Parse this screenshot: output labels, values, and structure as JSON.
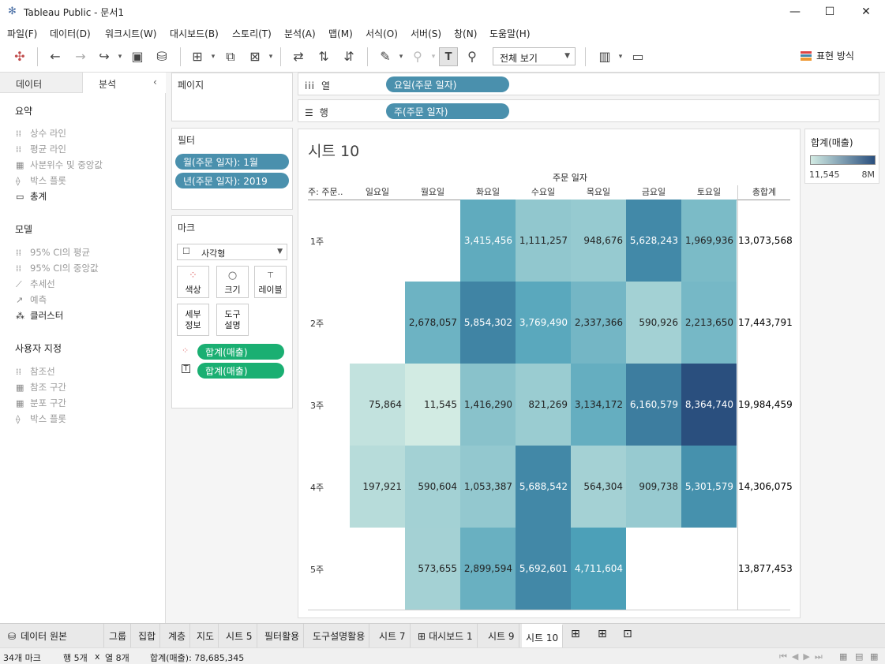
{
  "window": {
    "title": "Tableau Public - 문서1"
  },
  "menu": [
    "파일(F)",
    "데이터(D)",
    "워크시트(W)",
    "대시보드(B)",
    "스토리(T)",
    "분석(A)",
    "맵(M)",
    "서식(O)",
    "서버(S)",
    "창(N)",
    "도움말(H)"
  ],
  "toolbar": {
    "view_select": "전체 보기",
    "show_me": "표현 방식"
  },
  "left_panel": {
    "tab_data": "데이터",
    "tab_analysis": "분석",
    "summary_title": "요약",
    "summary_items": [
      "상수 라인",
      "평균 라인",
      "사분위수 및 중앙값",
      "박스 플롯",
      "총계"
    ],
    "model_title": "모델",
    "model_items": [
      "95% CI의 평균",
      "95% CI의 중앙값",
      "추세선",
      "예측",
      "클러스터"
    ],
    "custom_title": "사용자 지정",
    "custom_items": [
      "참조선",
      "참조 구간",
      "분포 구간",
      "박스 플롯"
    ]
  },
  "pages": {
    "title": "페이지"
  },
  "filters": {
    "title": "필터",
    "items": [
      "월(주문 일자): 1월",
      "년(주문 일자): 2019"
    ]
  },
  "marks": {
    "title": "마크",
    "type": "사각형",
    "buttons": [
      "색상",
      "크기",
      "레이블",
      "세부\n정보",
      "도구\n설명"
    ],
    "btn_color": "색상",
    "btn_size": "크기",
    "btn_label": "레이블",
    "btn_detail_1": "세부",
    "btn_detail_2": "정보",
    "btn_tooltip_1": "도구",
    "btn_tooltip_2": "설명",
    "pills": [
      "합계(매출)",
      "합계(매출)"
    ]
  },
  "shelves": {
    "columns_label": "열",
    "columns_pill": "요일(주문 일자)",
    "rows_label": "행",
    "rows_pill": "주(주문 일자)"
  },
  "sheet": {
    "title": "시트 10",
    "field_label": "주문 일자",
    "row_header": "주: 주문..",
    "columns": [
      "일요일",
      "월요일",
      "화요일",
      "수요일",
      "목요일",
      "금요일",
      "토요일"
    ],
    "total_label": "총합계"
  },
  "chart_data": {
    "type": "heatmap",
    "rows": [
      "1주",
      "2주",
      "3주",
      "4주",
      "5주"
    ],
    "columns": [
      "일요일",
      "월요일",
      "화요일",
      "수요일",
      "목요일",
      "금요일",
      "토요일"
    ],
    "values": [
      [
        null,
        null,
        3415456,
        1111257,
        948676,
        5628243,
        1969936
      ],
      [
        null,
        2678057,
        5854302,
        3769490,
        2337366,
        590926,
        2213650
      ],
      [
        75864,
        11545,
        1416290,
        821269,
        3134172,
        6160579,
        8364740
      ],
      [
        197921,
        590604,
        1053387,
        5688542,
        564304,
        909738,
        5301579
      ],
      [
        null,
        573655,
        2899594,
        5692601,
        4711604,
        null,
        null
      ]
    ],
    "labels": [
      [
        "",
        "",
        "3,415,456",
        "1,111,257",
        "948,676",
        "5,628,243",
        "1,969,936"
      ],
      [
        "",
        "2,678,057",
        "5,854,302",
        "3,769,490",
        "2,337,366",
        "590,926",
        "2,213,650"
      ],
      [
        "75,864",
        "11,545",
        "1,416,290",
        "821,269",
        "3,134,172",
        "6,160,579",
        "8,364,740"
      ],
      [
        "197,921",
        "590,604",
        "1,053,387",
        "5,688,542",
        "564,304",
        "909,738",
        "5,301,579"
      ],
      [
        "",
        "573,655",
        "2,899,594",
        "5,692,601",
        "4,711,604",
        "",
        ""
      ]
    ],
    "row_totals": [
      "13,073,568",
      "17,443,791",
      "19,984,459",
      "14,306,075",
      "13,877,453"
    ],
    "color_low": "#d2ebe3",
    "color_high": "#2a4f7e",
    "min": 11545,
    "max": 8364740
  },
  "legend": {
    "title": "합계(매출)",
    "min_label": "11,545",
    "max_label": "8M"
  },
  "tabs": [
    "데이터 원본",
    "그룹",
    "집합",
    "계층",
    "지도",
    "시트 5",
    "필터활용",
    "도구설명활용",
    "시트 7",
    "대시보드 1",
    "시트 9",
    "시트 10"
  ],
  "status": {
    "marks": "34개 마크",
    "rows": "행 5개",
    "x": "x",
    "cols": "열 8개",
    "sum": "합계(매출): 78,685,345"
  }
}
